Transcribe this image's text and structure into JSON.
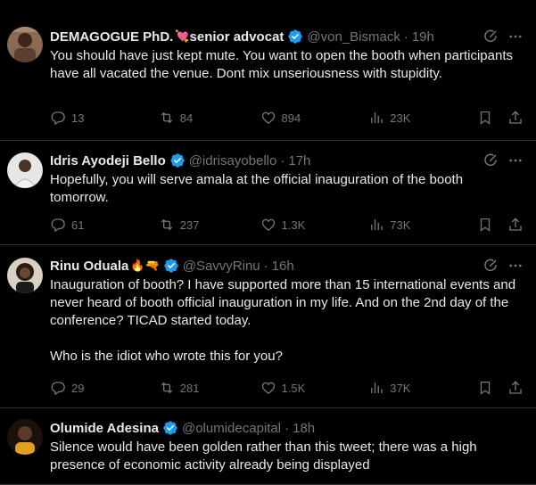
{
  "tweets": [
    {
      "name": "DEMAGOGUE PhD.",
      "name_emoji": "💘",
      "name_suffix": "senior advocat",
      "handle": "@von_Bismack",
      "time": "19h",
      "text": "You should have just kept mute. You want to open the booth when participants have all vacated the venue. Dont mix unseriousness with stupidity.",
      "replies": "13",
      "retweets": "84",
      "likes": "894",
      "views": "23K",
      "avatar_color": "#6b4a35"
    },
    {
      "name": "Idris Ayodeji Bello",
      "handle": "@idrisayobello",
      "time": "17h",
      "text": "Hopefully, you will serve amala at the official inauguration of the booth tomorrow.",
      "replies": "61",
      "retweets": "237",
      "likes": "1.3K",
      "views": "73K",
      "avatar_color": "#d9d9d9"
    },
    {
      "name": "Rinu Oduala",
      "name_emoji": "🔥🔫",
      "handle": "@SavvyRinu",
      "time": "16h",
      "text": "Inauguration of booth? I have supported more than 15 international events and never heard of booth official inauguration in my life. And on the 2nd day of the conference? TICAD started today.\n\nWho is the idiot who wrote this for you?",
      "replies": "29",
      "retweets": "281",
      "likes": "1.5K",
      "views": "37K",
      "avatar_color": "#c9c2b5"
    },
    {
      "name": "Olumide Adesina",
      "handle": "@olumidecapital",
      "time": "18h",
      "text": "Silence would have been golden rather than this tweet; there was a high presence of economic activity already being displayed",
      "avatar_color": "#3a2418"
    }
  ],
  "colors": {
    "background": "#000000",
    "text": "#e7e9ea",
    "secondary": "#71767b",
    "verified": "#1d9bf0",
    "divider": "#2f3336"
  },
  "icons": [
    "grok-icon",
    "more-icon",
    "reply-icon",
    "retweet-icon",
    "like-icon",
    "views-icon",
    "bookmark-icon",
    "share-icon",
    "verified-badge-icon"
  ]
}
